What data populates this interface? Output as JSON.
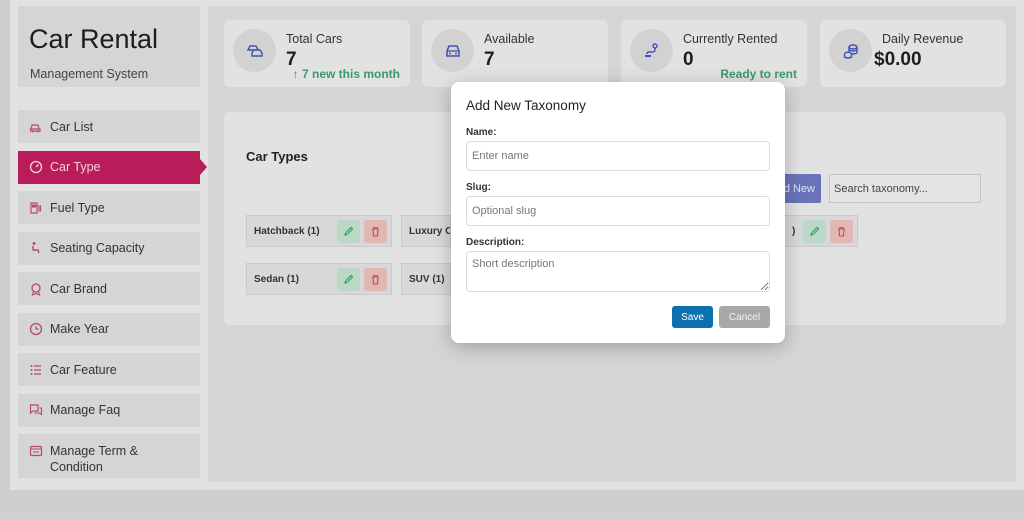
{
  "brand": {
    "title": "Car Rental",
    "subtitle": "Management System"
  },
  "sidebar": {
    "items": [
      {
        "label": "Car List",
        "icon": "car-list-icon"
      },
      {
        "label": "Car Type",
        "icon": "speedometer-icon",
        "active": true
      },
      {
        "label": "Fuel Type",
        "icon": "fuel-pump-icon"
      },
      {
        "label": "Seating Capacity",
        "icon": "seat-icon"
      },
      {
        "label": "Car Brand",
        "icon": "brand-badge-icon"
      },
      {
        "label": "Make Year",
        "icon": "clock-icon"
      },
      {
        "label": "Car Feature",
        "icon": "feature-list-icon"
      },
      {
        "label": "Manage Faq",
        "icon": "faq-chat-icon"
      },
      {
        "label": "Manage Term & Condition",
        "icon": "terms-icon"
      }
    ]
  },
  "stats": [
    {
      "label": "Total Cars",
      "value": "7",
      "note": "↑ 7 new this month",
      "icon": "cars-icon"
    },
    {
      "label": "Available",
      "value": "7",
      "note": "",
      "icon": "car-front-icon"
    },
    {
      "label": "Currently Rented",
      "value": "0",
      "note": "Ready to rent",
      "icon": "route-icon"
    },
    {
      "label": "Daily Revenue",
      "value": "$0.00",
      "note": "",
      "icon": "coins-icon"
    }
  ],
  "panel": {
    "title": "Car Types",
    "add_label": "d New",
    "search_placeholder": "Search taxonomy...",
    "chips": [
      {
        "label": "Hatchback (1)"
      },
      {
        "label": "Luxury Ca"
      },
      {
        "label": ")"
      },
      {
        "label": "Sedan (1)"
      },
      {
        "label": "SUV (1)"
      }
    ]
  },
  "modal": {
    "title": "Add New Taxonomy",
    "name_label": "Name:",
    "name_placeholder": "Enter name",
    "name_value": "",
    "slug_label": "Slug:",
    "slug_placeholder": "Optional slug",
    "slug_value": "",
    "description_label": "Description:",
    "description_placeholder": "Short description",
    "description_value": "",
    "save_label": "Save",
    "cancel_label": "Cancel"
  },
  "colors": {
    "accent_active": "#b81d5a",
    "save_button": "#0c6fb0",
    "cancel_button": "#a8a8a8",
    "positive_note": "#3a9a6a",
    "icon_pink": "#c2185b",
    "icon_blue": "#3f51b5"
  }
}
